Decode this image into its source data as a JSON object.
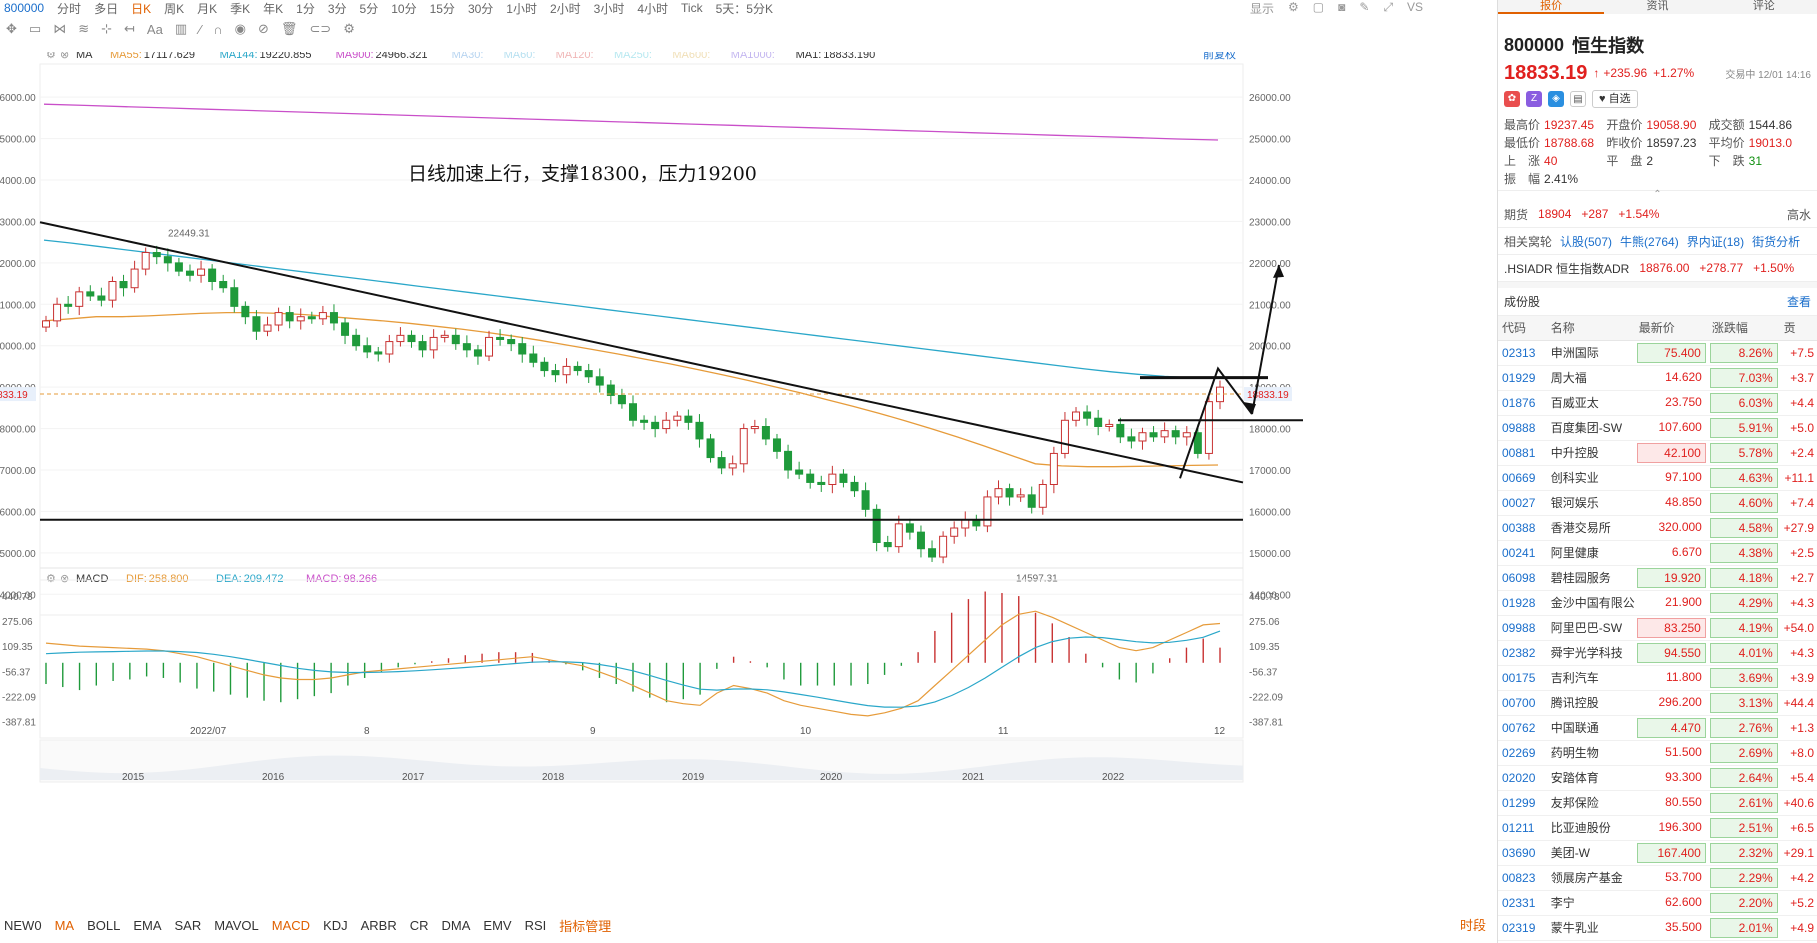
{
  "top": {
    "code": "800000",
    "periods": [
      "分时",
      "多日",
      "日K",
      "周K",
      "月K",
      "季K",
      "年K",
      "1分",
      "3分",
      "5分",
      "10分",
      "15分",
      "30分",
      "1小时",
      "2小时",
      "3小时",
      "4小时",
      "Tick",
      "5天：5分K"
    ],
    "selected_period": "日K",
    "display": "显示"
  },
  "ma_legend": {
    "label": "MA",
    "items": [
      {
        "name": "MA55:",
        "value": "17117.629",
        "color": "#e69b3a"
      },
      {
        "name": "MA144:",
        "value": "19220.855",
        "color": "#2aa7c9"
      },
      {
        "name": "MA900:",
        "value": "24966.321",
        "color": "#c94fc9"
      },
      {
        "name": "MA30:",
        "value": "",
        "color": "#b7d4f0"
      },
      {
        "name": "MA60:",
        "value": "",
        "color": "#b7e0f0"
      },
      {
        "name": "MA120:",
        "value": "",
        "color": "#f0b7b7"
      },
      {
        "name": "MA250:",
        "value": "",
        "color": "#b7e8f0"
      },
      {
        "name": "MA600:",
        "value": "",
        "color": "#f0dfb7"
      },
      {
        "name": "MA1000:",
        "value": "",
        "color": "#c4b7f0"
      },
      {
        "name": "MA1:",
        "value": "18833.190",
        "color": "#333333"
      }
    ],
    "fq": "前复权"
  },
  "macd_legend": {
    "label": "MACD",
    "items": [
      {
        "name": "DIF:",
        "value": "258.800",
        "color": "#e69b3a"
      },
      {
        "name": "DEA:",
        "value": "209.472",
        "color": "#2aa7c9"
      },
      {
        "name": "MACD:",
        "value": "98.266",
        "color": "#c94fc9"
      }
    ]
  },
  "annotation": "日线加速上行，支撑18300，压力19200",
  "chart_data": {
    "type": "candlestick",
    "y_ticks": [
      "26000.00",
      "25000.00",
      "24000.00",
      "23000.00",
      "22000.00",
      "21000.00",
      "20000.00",
      "19000.00",
      "18000.00",
      "17000.00",
      "16000.00",
      "15000.00",
      "14000.00"
    ],
    "ylim": [
      13500,
      26800
    ],
    "current_price": "18833.19",
    "high_label": "22449.31",
    "low_label": "14597.31",
    "x_labels": [
      "2022/07",
      "8",
      "9",
      "10",
      "11",
      "12"
    ],
    "macd_ticks": [
      "440.78",
      "275.06",
      "109.35",
      "-56.37",
      "-222.09",
      "-387.81"
    ],
    "macd_ylim": [
      -430,
      480
    ],
    "overview_labels": [
      "2015",
      "2016",
      "2017",
      "2018",
      "2019",
      "2020",
      "2021",
      "2022"
    ],
    "closes": [
      20600,
      21000,
      20950,
      21300,
      21200,
      21100,
      21550,
      21400,
      21850,
      22250,
      22150,
      22000,
      21800,
      21700,
      21850,
      21550,
      21400,
      20950,
      20700,
      20350,
      20500,
      20800,
      20600,
      20700,
      20650,
      20800,
      20550,
      20250,
      20000,
      19850,
      19800,
      20100,
      20250,
      20100,
      19900,
      20200,
      20250,
      20050,
      19900,
      19750,
      20200,
      20150,
      20050,
      19800,
      19600,
      19400,
      19300,
      19500,
      19400,
      19250,
      19050,
      18800,
      18600,
      18200,
      18150,
      18000,
      18200,
      18300,
      18150,
      17750,
      17300,
      17050,
      17150,
      18000,
      18050,
      17750,
      17450,
      17000,
      16900,
      16700,
      16650,
      16900,
      16700,
      16500,
      16050,
      15250,
      15150,
      15700,
      15500,
      15100,
      14900,
      15400,
      15600,
      15800,
      15650,
      16350,
      16550,
      16350,
      16400,
      16100,
      16650,
      17400,
      18200,
      18400,
      18250,
      18050,
      18100,
      17800,
      17700,
      17900,
      17800,
      17950,
      17800,
      17900,
      17400,
      18650,
      19000
    ],
    "ma55": [
      20600,
      20650,
      20700,
      20700,
      20720,
      20750,
      20780,
      20800,
      20800,
      20780,
      20750,
      20700,
      20650,
      20600,
      20540,
      20470,
      20400,
      20320,
      20230,
      20130,
      20020,
      19910,
      19800,
      19680,
      19560,
      19430,
      19300,
      19160,
      19010,
      18860,
      18700,
      18540,
      18370,
      18190,
      18000,
      17800,
      17590,
      17370,
      17150,
      17100,
      17080,
      17080,
      17090,
      17100,
      17110,
      17120
    ],
    "ma144": [
      22550,
      22480,
      22400,
      22320,
      22240,
      22160,
      22080,
      22000,
      21920,
      21840,
      21760,
      21680,
      21600,
      21520,
      21440,
      21360,
      21280,
      21200,
      21120,
      21040,
      20960,
      20880,
      20800,
      20720,
      20640,
      20560,
      20480,
      20400,
      20320,
      20240,
      20160,
      20080,
      20000,
      19920,
      19840,
      19760,
      19680,
      19600,
      19520,
      19440,
      19370,
      19310,
      19260,
      19230,
      19220
    ],
    "ma900": [
      25830,
      25800,
      25770,
      25740,
      25710,
      25680,
      25650,
      25620,
      25590,
      25560,
      25530,
      25500,
      25470,
      25440,
      25410,
      25380,
      25350,
      25320,
      25290,
      25260,
      25230,
      25200,
      25170,
      25140,
      25110,
      25080,
      25050,
      25020,
      24990,
      24966
    ],
    "dif": [
      130,
      120,
      110,
      105,
      100,
      95,
      90,
      80,
      60,
      40,
      10,
      -20,
      -50,
      -80,
      -100,
      -110,
      -110,
      -100,
      -80,
      -60,
      -50,
      -40,
      -30,
      -20,
      -10,
      0,
      10,
      20,
      30,
      40,
      20,
      0,
      -20,
      -60,
      -100,
      -150,
      -200,
      -250,
      -270,
      -280,
      -200,
      -150,
      -170,
      -200,
      -250,
      -280,
      -300,
      -320,
      -340,
      -350,
      -330,
      -300,
      -250,
      -150,
      -50,
      50,
      150,
      250,
      320,
      340,
      300,
      250,
      200,
      150,
      100,
      80,
      100,
      150,
      200,
      250,
      259
    ],
    "dea": [
      60,
      65,
      70,
      72,
      74,
      76,
      78,
      78,
      74,
      68,
      56,
      40,
      22,
      2,
      -18,
      -36,
      -50,
      -60,
      -64,
      -64,
      -62,
      -58,
      -53,
      -46,
      -39,
      -31,
      -23,
      -14,
      -5,
      4,
      7,
      6,
      1,
      -11,
      -29,
      -53,
      -83,
      -116,
      -147,
      -174,
      -180,
      -173,
      -173,
      -178,
      -192,
      -209,
      -227,
      -246,
      -265,
      -282,
      -292,
      -293,
      -285,
      -258,
      -216,
      -163,
      -100,
      -30,
      40,
      100,
      140,
      162,
      170,
      166,
      153,
      139,
      131,
      135,
      148,
      168,
      209
    ],
    "macd_bars": [
      -140,
      -160,
      -180,
      -150,
      -120,
      -110,
      -90,
      -100,
      -130,
      -170,
      -190,
      -210,
      -230,
      -250,
      -260,
      -240,
      -220,
      -200,
      -150,
      -100,
      -60,
      -30,
      -10,
      10,
      30,
      50,
      60,
      70,
      70,
      65,
      20,
      -10,
      -50,
      -100,
      -140,
      -190,
      -230,
      -260,
      -240,
      -210,
      -40,
      40,
      10,
      -30,
      -110,
      -150,
      -150,
      -150,
      -150,
      -140,
      -80,
      -20,
      70,
      210,
      330,
      420,
      470,
      460,
      440,
      330,
      260,
      170,
      60,
      -30,
      -110,
      -130,
      -70,
      30,
      100,
      160,
      100
    ]
  },
  "bottom_tabs": [
    "NEW0",
    "MA",
    "BOLL",
    "EMA",
    "SAR",
    "MAVOL",
    "MACD",
    "KDJ",
    "ARBR",
    "CR",
    "DMA",
    "EMV",
    "RSI",
    "指标管理"
  ],
  "bottom_right": "时段",
  "panel": {
    "tabs": [
      "报价",
      "资讯",
      "评论"
    ],
    "code": "800000",
    "name": "恒生指数",
    "price": "18833.19",
    "change": "+235.96",
    "pct": "+1.27%",
    "status": "交易中 12/01 14:16",
    "self_select": "自选",
    "stats": [
      [
        {
          "l": "最高价",
          "v": "19237.45",
          "c": "r"
        },
        {
          "l": "开盘价",
          "v": "19058.90",
          "c": "r"
        },
        {
          "l": "成交额",
          "v": "1544.86",
          "c": ""
        }
      ],
      [
        {
          "l": "最低价",
          "v": "18788.68",
          "c": "r"
        },
        {
          "l": "昨收价",
          "v": "18597.23",
          "c": ""
        },
        {
          "l": "平均价",
          "v": "19013.0",
          "c": "r"
        }
      ],
      [
        {
          "l": "上　涨",
          "v": "40",
          "c": "r"
        },
        {
          "l": "平　盘",
          "v": "2",
          "c": ""
        },
        {
          "l": "下　跌",
          "v": "31",
          "c": "g"
        }
      ],
      [
        {
          "l": "振　幅",
          "v": "2.41%",
          "c": ""
        }
      ]
    ],
    "futures": {
      "label": "期货",
      "v1": "18904",
      "v2": "+287",
      "v3": "+1.54%",
      "tail": "高水"
    },
    "related": {
      "label": "相关窝轮",
      "items": [
        "认股(507)",
        "牛熊(2764)",
        "界内证(18)",
        "街货分析"
      ]
    },
    "adr": {
      "name": ".HSIADR 恒生指数ADR",
      "v": "18876.00",
      "c": "+278.77",
      "p": "+1.50%"
    },
    "cf_title": "成份股",
    "cf_more": "查看",
    "cols": [
      "代码",
      "名称",
      "最新价",
      "涨跌幅",
      "贡"
    ],
    "rows": [
      [
        "02313",
        "申洲国际",
        "75.400",
        "8.26%",
        "+7.5"
      ],
      [
        "01929",
        "周大福",
        "14.620",
        "7.03%",
        "+3.7"
      ],
      [
        "01876",
        "百威亚太",
        "23.750",
        "6.03%",
        "+4.4"
      ],
      [
        "09888",
        "百度集团-SW",
        "107.600",
        "5.91%",
        "+5.0"
      ],
      [
        "00881",
        "中升控股",
        "42.100",
        "5.78%",
        "+2.4"
      ],
      [
        "00669",
        "创科实业",
        "97.100",
        "4.63%",
        "+11.1"
      ],
      [
        "00027",
        "银河娱乐",
        "48.850",
        "4.60%",
        "+7.4"
      ],
      [
        "00388",
        "香港交易所",
        "320.000",
        "4.58%",
        "+27.9"
      ],
      [
        "00241",
        "阿里健康",
        "6.670",
        "4.38%",
        "+2.5"
      ],
      [
        "06098",
        "碧桂园服务",
        "19.920",
        "4.18%",
        "+2.7"
      ],
      [
        "01928",
        "金沙中国有限公司",
        "21.900",
        "4.29%",
        "+4.3"
      ],
      [
        "09988",
        "阿里巴巴-SW",
        "83.250",
        "4.19%",
        "+54.0"
      ],
      [
        "02382",
        "舜宇光学科技",
        "94.550",
        "4.01%",
        "+4.3"
      ],
      [
        "00175",
        "吉利汽车",
        "11.800",
        "3.69%",
        "+3.9"
      ],
      [
        "00700",
        "腾讯控股",
        "296.200",
        "3.13%",
        "+44.4"
      ],
      [
        "00762",
        "中国联通",
        "4.470",
        "2.76%",
        "+1.3"
      ],
      [
        "02269",
        "药明生物",
        "51.500",
        "2.69%",
        "+8.0"
      ],
      [
        "02020",
        "安踏体育",
        "93.300",
        "2.64%",
        "+5.4"
      ],
      [
        "01299",
        "友邦保险",
        "80.550",
        "2.61%",
        "+40.6"
      ],
      [
        "01211",
        "比亚迪股份",
        "196.300",
        "2.51%",
        "+6.5"
      ],
      [
        "03690",
        "美团-W",
        "167.400",
        "2.32%",
        "+29.1"
      ],
      [
        "00823",
        "领展房产基金",
        "53.700",
        "2.29%",
        "+4.2"
      ],
      [
        "02331",
        "李宁",
        "62.600",
        "2.20%",
        "+5.2"
      ],
      [
        "02319",
        "蒙牛乳业",
        "35.500",
        "2.01%",
        "+4.9"
      ]
    ]
  }
}
